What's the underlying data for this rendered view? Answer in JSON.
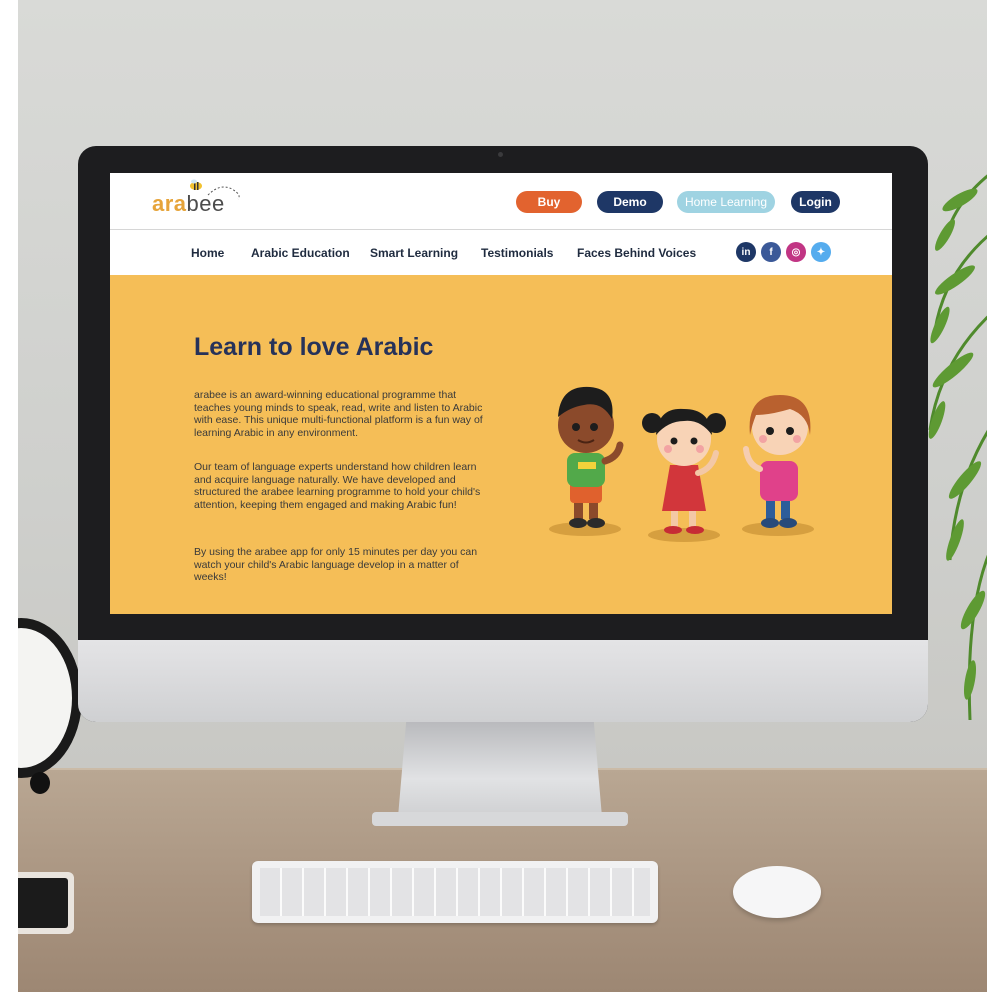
{
  "site": {
    "logo": {
      "part1": "ara",
      "part2": "bee"
    },
    "header_buttons": {
      "buy": "Buy",
      "demo": "Demo",
      "home_learning": "Home Learning",
      "login": "Login"
    },
    "nav": [
      "Home",
      "Arabic Education",
      "Smart Learning",
      "Testimonials",
      "Faces Behind Voices"
    ],
    "social": [
      {
        "name": "linkedin-icon",
        "glyph": "in",
        "color": "#1e3766"
      },
      {
        "name": "facebook-icon",
        "glyph": "f",
        "color": "#3b5998"
      },
      {
        "name": "instagram-icon",
        "glyph": "◎",
        "color": "#c13584"
      },
      {
        "name": "twitter-icon",
        "glyph": "✦",
        "color": "#55acee"
      }
    ],
    "hero": {
      "title": "Learn to love Arabic",
      "paragraphs": [
        "arabee is an award-winning educational programme that teaches young minds to speak, read, write and listen to Arabic with ease. This unique multi-functional platform is a fun way of learning Arabic in any environment.",
        "Our team of language experts understand how children learn and acquire language naturally. We have developed and structured the arabee learning programme to hold your child's attention, keeping them engaged and making Arabic fun!",
        "By using the arabee app for only 15 minutes per day you can watch your child's Arabic language develop in a matter of weeks!"
      ]
    }
  },
  "colors": {
    "hero_bg": "#f5be57",
    "navy": "#1e3766",
    "orange": "#e2632f",
    "light_blue": "#9fd3e2",
    "logo_gold": "#e6a43a"
  }
}
